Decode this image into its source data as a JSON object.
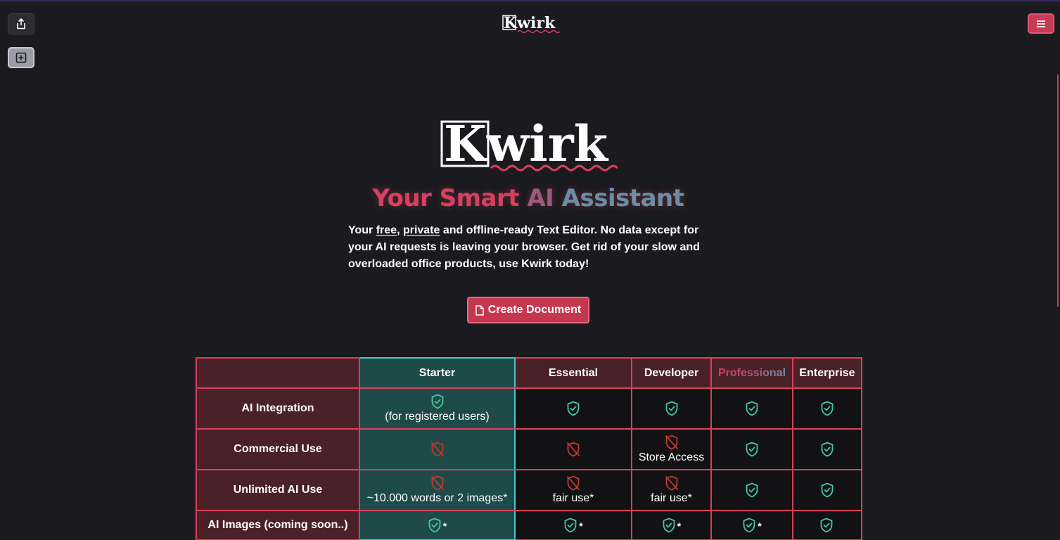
{
  "app": {
    "brand": "Kwirk"
  },
  "toolbar": {
    "share_icon": "share-icon",
    "add_icon": "add-square-icon",
    "menu_icon": "hamburger-menu-icon"
  },
  "hero": {
    "headline_parts": [
      "Your Smart ",
      "AI ",
      "Assistant"
    ],
    "description": {
      "part1": "Your ",
      "free": "free",
      "comma": ", ",
      "private": "private",
      "part2": " and offline-ready Text Editor. No data except for your AI requests is leaving your browser. Get rid of your slow and overloaded office products, use Kwirk today!"
    },
    "create_button": "Create Document"
  },
  "colors": {
    "accent": "#c83a55",
    "accent_border": "#d8405a",
    "starter_bg": "#1f4a4a",
    "starter_border": "#48c9c1",
    "row_header_bg": "#4b2128",
    "check": "#45c6a0",
    "cross": "#c0392b"
  },
  "pricing": {
    "columns": [
      "Starter",
      "Essential",
      "Developer",
      "Professional",
      "Enterprise"
    ],
    "rows": [
      {
        "label": "AI Integration",
        "cells": [
          {
            "icon": "check",
            "text": "(for registered users)"
          },
          {
            "icon": "check",
            "text": ""
          },
          {
            "icon": "check",
            "text": ""
          },
          {
            "icon": "check",
            "text": ""
          },
          {
            "icon": "check",
            "text": ""
          }
        ]
      },
      {
        "label": "Commercial Use",
        "cells": [
          {
            "icon": "cross",
            "text": ""
          },
          {
            "icon": "cross",
            "text": ""
          },
          {
            "icon": "cross",
            "text": "Store Access"
          },
          {
            "icon": "check",
            "text": ""
          },
          {
            "icon": "check",
            "text": ""
          }
        ]
      },
      {
        "label": "Unlimited AI Use",
        "cells": [
          {
            "icon": "cross",
            "text": "~10.000 words or 2 images*"
          },
          {
            "icon": "cross",
            "text": "fair use*"
          },
          {
            "icon": "cross",
            "text": "fair use*"
          },
          {
            "icon": "check",
            "text": ""
          },
          {
            "icon": "check",
            "text": ""
          }
        ]
      },
      {
        "label": "AI Images (coming soon..)",
        "cells": [
          {
            "icon": "check",
            "star": "*"
          },
          {
            "icon": "check",
            "star": "*"
          },
          {
            "icon": "check",
            "star": "*"
          },
          {
            "icon": "check",
            "star": "*"
          },
          {
            "icon": "check",
            "star": ""
          }
        ]
      }
    ]
  }
}
